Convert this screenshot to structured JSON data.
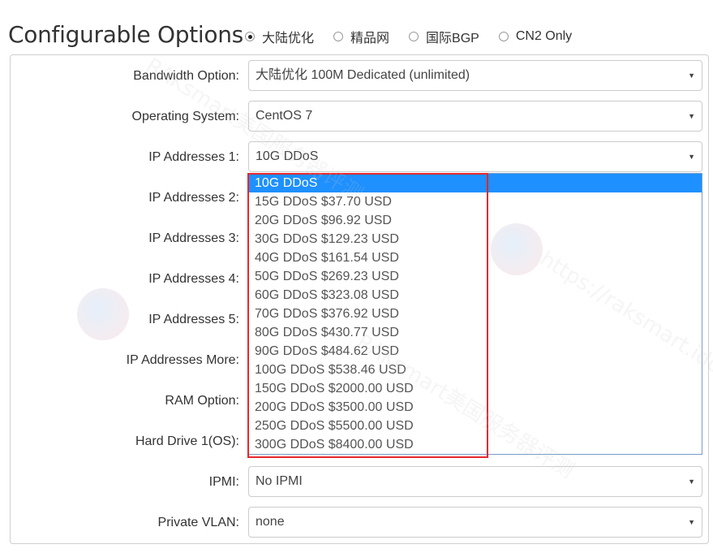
{
  "page_title": "Configurable Options",
  "radio_options": [
    {
      "label": "大陆优化",
      "checked": true
    },
    {
      "label": "精品网",
      "checked": false
    },
    {
      "label": "国际BGP",
      "checked": false
    },
    {
      "label": "CN2 Only",
      "checked": false
    }
  ],
  "fields": [
    {
      "label": "Bandwidth Option:",
      "value": "大陆优化 100M Dedicated (unlimited)"
    },
    {
      "label": "Operating System:",
      "value": "CentOS 7"
    },
    {
      "label": "IP Addresses 1:",
      "value": "10G DDoS"
    },
    {
      "label": "IP Addresses 2:",
      "value": ""
    },
    {
      "label": "IP Addresses 3:",
      "value": ""
    },
    {
      "label": "IP Addresses 4:",
      "value": ""
    },
    {
      "label": "IP Addresses 5:",
      "value": ""
    },
    {
      "label": "IP Addresses More:",
      "value": ""
    },
    {
      "label": "RAM Option:",
      "value": ""
    },
    {
      "label": "Hard Drive 1(OS):",
      "value": ""
    },
    {
      "label": "IPMI:",
      "value": "No IPMI"
    },
    {
      "label": "Private VLAN:",
      "value": "none"
    }
  ],
  "dropdown_options": [
    "10G DDoS",
    "15G DDoS $37.70 USD",
    "20G DDoS $96.92 USD",
    "30G DDoS $129.23 USD",
    "40G DDoS $161.54 USD",
    "50G DDoS $269.23 USD",
    "60G DDoS $323.08 USD",
    "70G DDoS $376.92 USD",
    "80G DDoS $430.77 USD",
    "90G DDoS $484.62 USD",
    "100G DDoS $538.46 USD",
    "150G DDoS $2000.00 USD",
    "200G DDoS $3500.00 USD",
    "250G DDoS $5500.00 USD",
    "300G DDoS $8400.00 USD"
  ],
  "dropdown_selected": "10G DDoS",
  "caret_glyph": "▼",
  "watermark": {
    "brand": "RAKsmart美国服务器评测",
    "url": "https://raksmart.idcspy.com/"
  },
  "colors": {
    "selected_option_bg": "#1e90ff",
    "highlight_border": "#e8272b"
  }
}
